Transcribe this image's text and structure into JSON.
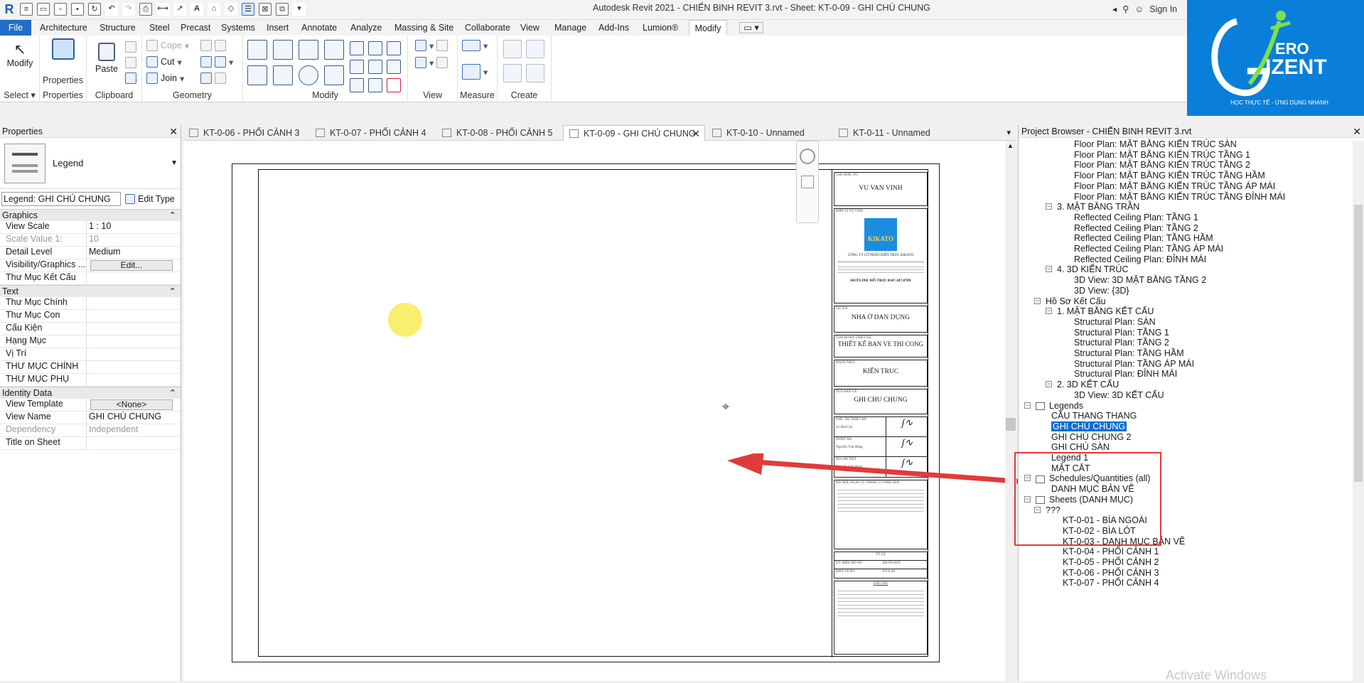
{
  "app": {
    "title": "Autodesk Revit 2021 - CHIẾN BINH REVIT 3.rvt - Sheet: KT-0-09 - GHI CHÚ CHUNG",
    "sign_in": "Sign In"
  },
  "ribbon_tabs": [
    "File",
    "Architecture",
    "Structure",
    "Steel",
    "Precast",
    "Systems",
    "Insert",
    "Annotate",
    "Analyze",
    "Massing & Site",
    "Collaborate",
    "View",
    "Manage",
    "Add-Ins",
    "Lumion®",
    "Modify"
  ],
  "ribbon": {
    "select": {
      "modify_label": "Modify",
      "panel": "Select"
    },
    "properties": {
      "button": "Properties",
      "panel": "Properties"
    },
    "clipboard": {
      "paste": "Paste",
      "panel": "Clipboard"
    },
    "geometry": {
      "cope": "Cope",
      "cut": "Cut",
      "join": "Join",
      "panel": "Geometry"
    },
    "modify_panel": "Modify",
    "view_panel": "View",
    "measure_panel": "Measure",
    "create_panel": "Create"
  },
  "logo": {
    "line1": "ERO",
    "line2": "IZENT",
    "tagline": "HỌC THỰC TẾ - ỨNG DỤNG NHANH"
  },
  "properties": {
    "title": "Properties",
    "type_name": "Legend",
    "selector": "Legend: GHI CHÚ CHUNG",
    "edit_type": "Edit Type",
    "sections": {
      "graphics": "Graphics",
      "text": "Text",
      "identity": "Identity Data"
    },
    "graphics_rows": [
      {
        "k": "View Scale",
        "v": "1 : 10",
        "dis": false
      },
      {
        "k": "Scale Value    1:",
        "v": "10",
        "dis": true
      },
      {
        "k": "Detail Level",
        "v": "Medium",
        "dis": false
      },
      {
        "k": "Visibility/Graphics ...",
        "v": "Edit...",
        "btn": true
      },
      {
        "k": "Thư Mục Kết Cấu",
        "v": "",
        "dis": false
      }
    ],
    "text_rows": [
      "Thư Mục Chính",
      "Thư Mục Con",
      "Cấu Kiện",
      "Hạng Mục",
      "Vị Trí",
      "THƯ MỤC CHÍNH",
      "THƯ MỤC PHỤ"
    ],
    "identity_rows": [
      {
        "k": "View Template",
        "v": "<None>",
        "btn": true
      },
      {
        "k": "View Name",
        "v": "GHI CHÚ CHUNG",
        "dis": false
      },
      {
        "k": "Dependency",
        "v": "Independent",
        "dis": true
      },
      {
        "k": "Title on Sheet",
        "v": "",
        "dis": false
      }
    ]
  },
  "view_tabs": [
    {
      "label": "KT-0-06 - PHỐI CẢNH 3",
      "active": false
    },
    {
      "label": "KT-0-07 - PHỐI CẢNH 4",
      "active": false
    },
    {
      "label": "KT-0-08 - PHỐI CẢNH 5",
      "active": false
    },
    {
      "label": "KT-0-09 - GHI CHÚ CHUNG",
      "active": true
    },
    {
      "label": "KT-0-10 - Unnamed",
      "active": false
    },
    {
      "label": "KT-0-11 - Unnamed",
      "active": false
    }
  ],
  "titleblock": {
    "owner_label": "CHỦ ĐẦU TƯ:",
    "owner": "VU VAN VINH",
    "consultant_label": "ĐƠN VỊ TƯ VẤN:",
    "company": "CÔNG TY CỔ PHẦN KIẾN TRÚC KIKATO",
    "hotline": "HOTLINE HỖ TRỢ: 0347.187.8789",
    "project_label": "DỰ ÁN:",
    "project": "NHA Ở DAN DỤNG",
    "stage_label": "GIAI ĐOẠN THIẾT KẾ:",
    "stage": "THIẾT KẾ BAN VE THI CONG",
    "category_label": "HẠNG MỤC:",
    "category": "KIẾN TRUC",
    "sheetname_label": "TÊN BẢN VẼ:",
    "sheetname": "GHI CHU CHUNG",
    "sign_rows": [
      "CHỦ TRÌ THIẾT KẾ",
      "THIẾT KẾ",
      "BỘ CHI TIẾT"
    ],
    "sign_names": [
      "Lê Hoà Cát",
      "Nguyễn Văn Hùng",
      "Nguyễn Văn Hùng"
    ],
    "date": "HÀ NỘI, NGÀY 25 THÁNG 11 NĂM 2020",
    "scale_label": "TỶ LỆ",
    "code_label": "KÝ HIỆU HỒ SƠ",
    "code": "BE-NV.HOI",
    "sheetno_label": "BẢN VẼ SỐ",
    "sheetno": "KT-0-09",
    "note_label": "GHI CHÚ"
  },
  "project_browser": {
    "title": "Project Browser - CHIẾN BINH REVIT 3.rvt",
    "items": [
      {
        "t": "Floor Plan: MẶT BẰNG KIẾN TRÚC SÀN",
        "lvl": 3
      },
      {
        "t": "Floor Plan: MẶT BẰNG KIẾN TRÚC TẦNG 1",
        "lvl": 3
      },
      {
        "t": "Floor Plan: MẶT BẰNG KIẾN TRÚC TẦNG 2",
        "lvl": 3
      },
      {
        "t": "Floor Plan: MẶT BẰNG KIẾN TRÚC TẦNG HẦM",
        "lvl": 3
      },
      {
        "t": "Floor Plan: MẶT BẰNG KIẾN TRÚC TẦNG ÁP MÁI",
        "lvl": 3
      },
      {
        "t": "Floor Plan: MẶT BẰNG KIẾN TRÚC TẦNG ĐỈNH MÁI",
        "lvl": 3
      },
      {
        "t": "3. MẶT BẰNG TRẦN",
        "lvl": 2,
        "tg": "−"
      },
      {
        "t": "Reflected Ceiling Plan: TẦNG 1",
        "lvl": 3
      },
      {
        "t": "Reflected Ceiling Plan: TẦNG 2",
        "lvl": 3
      },
      {
        "t": "Reflected Ceiling Plan: TẦNG HẦM",
        "lvl": 3
      },
      {
        "t": "Reflected Ceiling Plan: TẦNG ÁP MÁI",
        "lvl": 3
      },
      {
        "t": "Reflected Ceiling Plan: ĐỈNH MÁI",
        "lvl": 3
      },
      {
        "t": "4. 3D KIẾN TRÚC",
        "lvl": 2,
        "tg": "−"
      },
      {
        "t": "3D View: 3D MẶT BẰNG TẦNG 2",
        "lvl": 3
      },
      {
        "t": "3D View: {3D}",
        "lvl": 3
      },
      {
        "t": "Hồ Sơ Kết Cấu",
        "lvl": 1,
        "tg": "−"
      },
      {
        "t": "1. MẶT BẰNG KẾT CẤU",
        "lvl": 2,
        "tg": "−"
      },
      {
        "t": "Structural Plan: SÀN",
        "lvl": 3
      },
      {
        "t": "Structural Plan: TẦNG 1",
        "lvl": 3
      },
      {
        "t": "Structural Plan: TẦNG 2",
        "lvl": 3
      },
      {
        "t": "Structural Plan: TẦNG HẦM",
        "lvl": 3
      },
      {
        "t": "Structural Plan: TẦNG ÁP MÁI",
        "lvl": 3
      },
      {
        "t": "Structural Plan: ĐỈNH MÁI",
        "lvl": 3
      },
      {
        "t": "2. 3D KẾT CẤU",
        "lvl": 2,
        "tg": "−"
      },
      {
        "t": "3D View: 3D KẾT CẤU",
        "lvl": 3
      },
      {
        "t": "Legends",
        "lvl": 0,
        "tg": "−",
        "icon": true
      },
      {
        "t": "CẦU THANG THANG",
        "lvl": 1.5
      },
      {
        "t": "GHI CHÚ CHUNG",
        "lvl": 1.5,
        "sel": true
      },
      {
        "t": "GHI CHÚ CHUNG 2",
        "lvl": 1.5
      },
      {
        "t": "GHI CHÚ SÀN",
        "lvl": 1.5
      },
      {
        "t": "Legend 1",
        "lvl": 1.5
      },
      {
        "t": "MẶT CẮT",
        "lvl": 1.5
      },
      {
        "t": "Schedules/Quantities (all)",
        "lvl": 0,
        "tg": "−",
        "icon": true
      },
      {
        "t": "DANH MỤC BẢN VẼ",
        "lvl": 1.5
      },
      {
        "t": "Sheets (DANH MỤC)",
        "lvl": 0,
        "tg": "−",
        "icon": true
      },
      {
        "t": "???",
        "lvl": 1,
        "tg": "−"
      },
      {
        "t": "KT-0-01 - BÌA NGOÀI",
        "lvl": 2.5
      },
      {
        "t": "KT-0-02 - BÌA LÓT",
        "lvl": 2.5
      },
      {
        "t": "KT-0-03 - DANH MỤC BẢN VẼ",
        "lvl": 2.5
      },
      {
        "t": "KT-0-04 - PHỐI CẢNH 1",
        "lvl": 2.5
      },
      {
        "t": "KT-0-05 - PHỐI CẢNH 2",
        "lvl": 2.5
      },
      {
        "t": "KT-0-06 - PHỐI CẢNH 3",
        "lvl": 2.5
      },
      {
        "t": "KT-0-07 - PHỐI CẢNH 4",
        "lvl": 2.5
      }
    ]
  },
  "colors": {
    "accent": "#1f6fc7",
    "selection": "#0a6fd6",
    "annotation": "#e23a3a",
    "logo_bg": "#0a7fd9"
  },
  "watermark": "Activate Windows"
}
